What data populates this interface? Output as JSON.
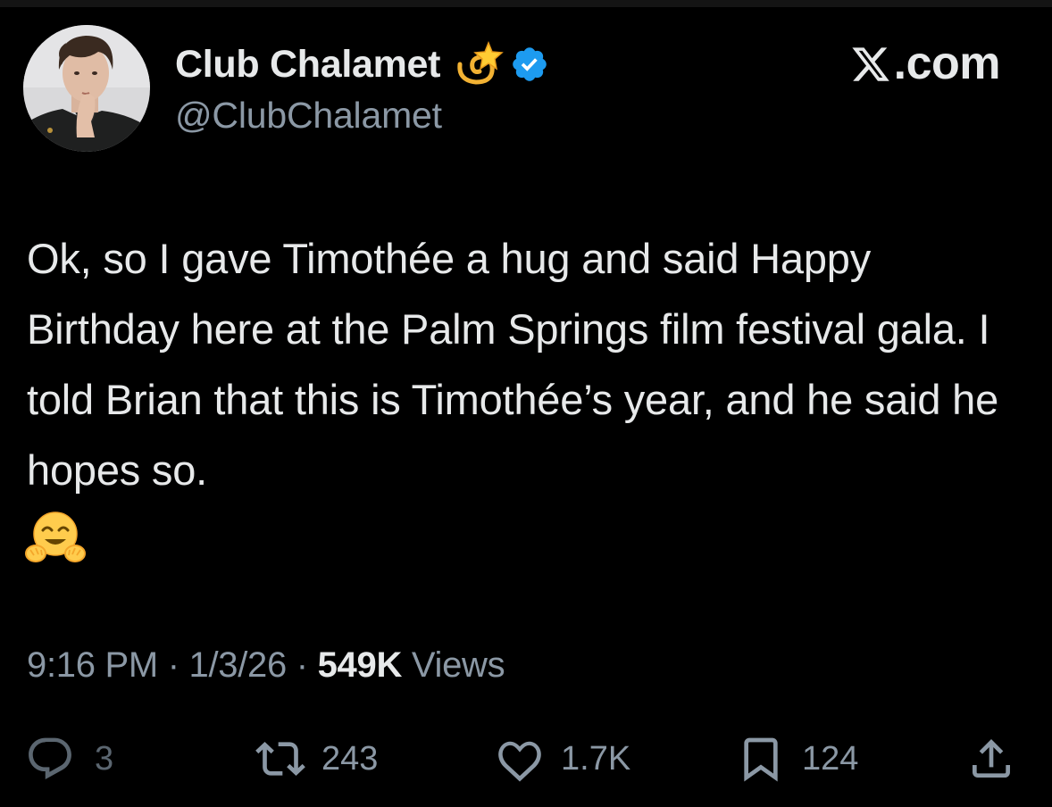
{
  "header": {
    "display_name": "Club Chalamet",
    "name_emoji": "dizzy-star-emoji",
    "verified_badge": "verified-badge-icon",
    "handle": "@ClubChalamet",
    "brand_text": ".com",
    "brand_icon": "x-logo-icon"
  },
  "tweet": {
    "text": "Ok, so I gave Timothée a hug and said Happy Birthday here at the Palm Springs film festival gala. I told Brian that this is Timothée’s year, and he said he hopes so.",
    "trailing_emoji": "hugging-face-emoji"
  },
  "meta": {
    "time": "9:16 PM",
    "separator": " · ",
    "date": "1/3/26",
    "views_count": "549K",
    "views_label": " Views"
  },
  "actions": {
    "replies": "3",
    "reposts": "243",
    "likes": "1.7K",
    "bookmarks": "124"
  },
  "colors": {
    "background": "#000000",
    "primary_text": "#e7e9ea",
    "secondary_text": "#8b98a5",
    "verified_blue": "#1d9bf0"
  }
}
